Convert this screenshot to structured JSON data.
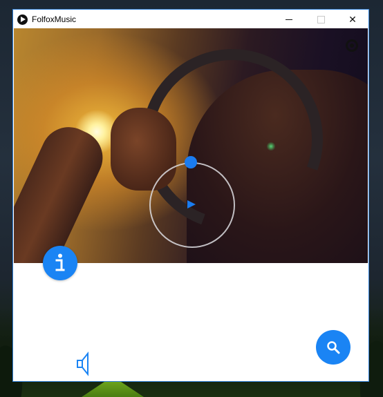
{
  "window": {
    "title": "FolfoxMusic",
    "controls": {
      "minimize": "minimize-icon",
      "maximize": "maximize-icon",
      "close": "close-icon",
      "close_glyph": "✕"
    }
  },
  "player": {
    "settings_icon": "settings-icon",
    "play_icon": "play-icon",
    "seek_knob": "seek-knob",
    "progress": 0.0,
    "info_icon": "info-icon",
    "search_icon": "search-icon",
    "volume_icon": "volume-icon"
  },
  "colors": {
    "accent": "#1a84f4",
    "window_border": "#2f7fd8",
    "ring": "#dcdce1"
  }
}
